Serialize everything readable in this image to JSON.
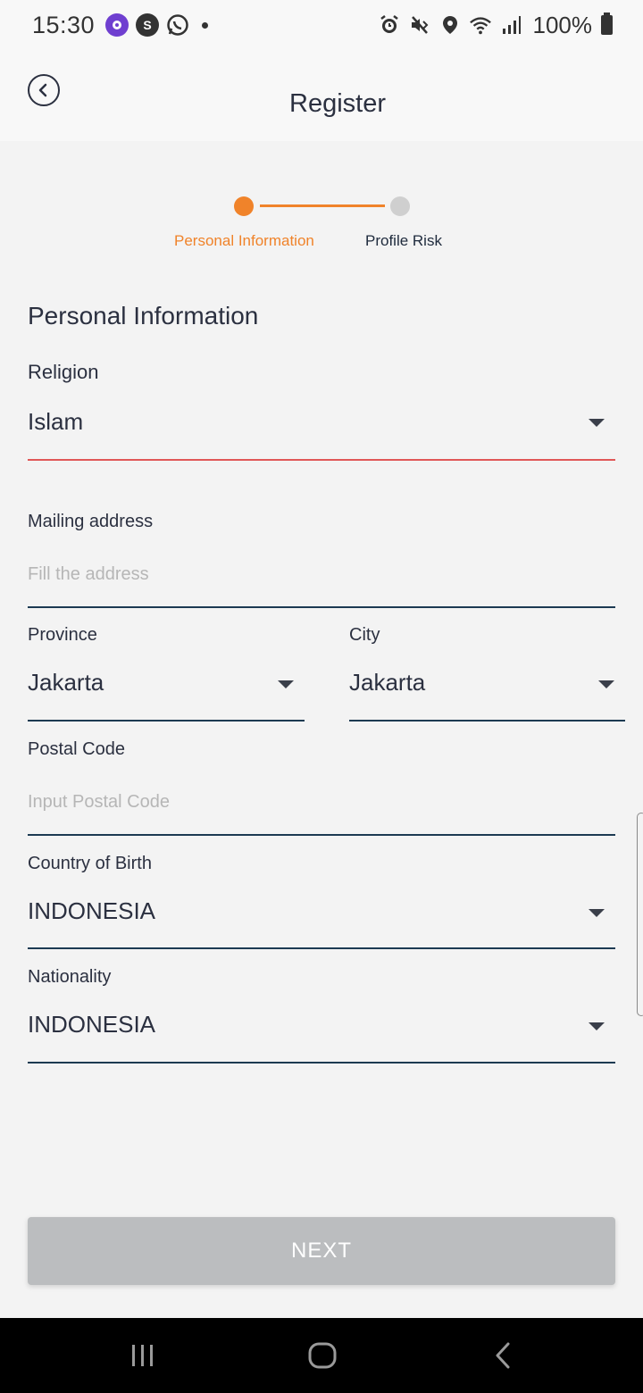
{
  "status_bar": {
    "time": "15:30",
    "badge_s": "S",
    "battery": "100%",
    "icons": [
      "alarm-icon",
      "mute-vibrate-icon",
      "location-icon",
      "wifi-icon",
      "signal-icon",
      "battery-icon"
    ]
  },
  "header": {
    "title": "Register"
  },
  "stepper": {
    "steps": [
      {
        "label": "Personal Information",
        "state": "active"
      },
      {
        "label": "Profile Risk",
        "state": "inactive"
      }
    ],
    "accent": "#f0832a",
    "inactive_color": "#cfcfcf"
  },
  "form": {
    "section_title": "Personal Information",
    "religion": {
      "label": "Religion",
      "value": "Islam"
    },
    "mailing_address": {
      "label": "Mailing address",
      "placeholder": "Fill the address"
    },
    "province": {
      "label": "Province",
      "value": "Jakarta"
    },
    "city": {
      "label": "City",
      "value": "Jakarta"
    },
    "postal_code": {
      "label": "Postal Code",
      "placeholder": "Input Postal Code"
    },
    "country_of_birth": {
      "label": "Country of Birth",
      "value": "INDONESIA"
    },
    "nationality": {
      "label": "Nationality",
      "value": "INDONESIA"
    }
  },
  "actions": {
    "next_label": "NEXT"
  },
  "colors": {
    "error_line": "#e05757",
    "field_line": "#1c3a52",
    "disabled_button": "#bbbdbf"
  }
}
